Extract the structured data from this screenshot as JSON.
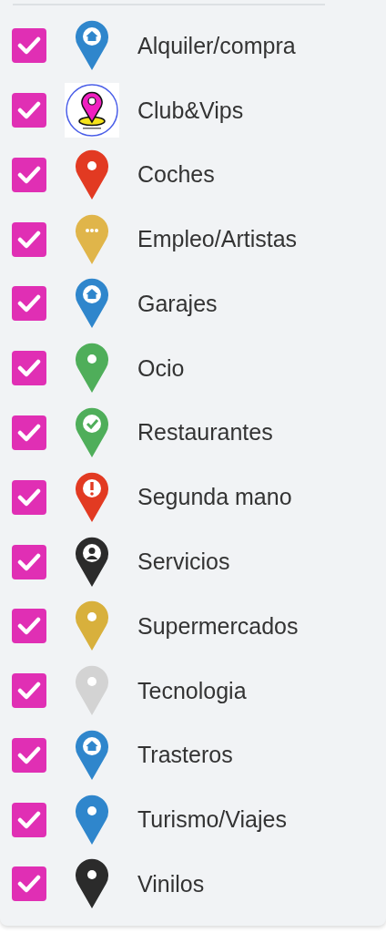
{
  "categories": [
    {
      "label": "Alquiler/compra",
      "checked": true,
      "kind": "home",
      "color": "#2f86cc"
    },
    {
      "label": "Club&Vips",
      "checked": true,
      "kind": "logo"
    },
    {
      "label": "Coches",
      "checked": true,
      "kind": "dot",
      "color": "#e23a22"
    },
    {
      "label": "Empleo/Artistas",
      "checked": true,
      "kind": "dots",
      "color": "#e0b54a"
    },
    {
      "label": "Garajes",
      "checked": true,
      "kind": "home",
      "color": "#2f86cc"
    },
    {
      "label": "Ocio",
      "checked": true,
      "kind": "dot",
      "color": "#4fae5a"
    },
    {
      "label": "Restaurantes",
      "checked": true,
      "kind": "check",
      "color": "#4fae5a"
    },
    {
      "label": "Segunda mano",
      "checked": true,
      "kind": "alert",
      "color": "#e23a22"
    },
    {
      "label": "Servicios",
      "checked": true,
      "kind": "person",
      "color": "#2b2b2b"
    },
    {
      "label": "Supermercados",
      "checked": true,
      "kind": "dot",
      "color": "#d8b03c"
    },
    {
      "label": "Tecnologia",
      "checked": true,
      "kind": "dot",
      "color": "#d3d3d3"
    },
    {
      "label": "Trasteros",
      "checked": true,
      "kind": "home",
      "color": "#2f86cc"
    },
    {
      "label": "Turismo/Viajes",
      "checked": true,
      "kind": "dot",
      "color": "#2f86cc"
    },
    {
      "label": "Vinilos",
      "checked": true,
      "kind": "dot",
      "color": "#2b2b2b"
    }
  ]
}
